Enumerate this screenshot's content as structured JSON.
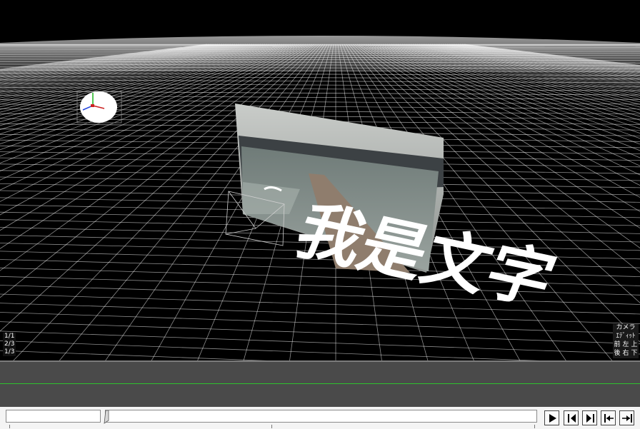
{
  "viewport": {
    "overlay_text": "我是文字",
    "layer_labels": [
      "1/1",
      "2/3",
      "1/3"
    ],
    "camera_buttons": {
      "camera": "カメラ",
      "edit": "ｴﾃﾞｨｯﾄ",
      "front": "前",
      "left": "左",
      "up": "上",
      "back": "後",
      "right": "右",
      "down": "下"
    }
  },
  "controls": {
    "play_icon": "play-icon",
    "prev_frame_icon": "step-back-icon",
    "next_frame_icon": "step-forward-icon",
    "start_icon": "skip-start-icon",
    "end_icon": "skip-end-icon"
  },
  "colors": {
    "grid_line": "#ffffff",
    "timeline_bg": "#4a4a4a",
    "timeline_marker": "#2ec22e"
  }
}
